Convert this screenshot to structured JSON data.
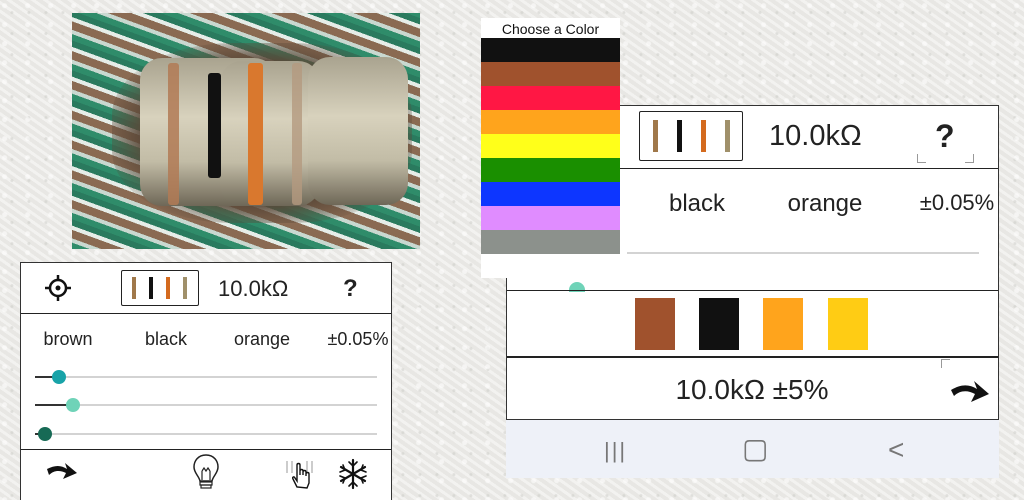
{
  "left_phone": {
    "value": "10.0kΩ",
    "help": "?",
    "band_names": [
      "brown",
      "black",
      "orange",
      "±0.05%"
    ],
    "band_colors": [
      "#a0784a",
      "#111111",
      "#d46a1e",
      "#a0906a"
    ],
    "sliders": [
      {
        "level": 0.07,
        "color": "#18a3a8"
      },
      {
        "level": 0.11,
        "color": "#6fd3b8"
      },
      {
        "level": 0.03,
        "color": "#176a55"
      }
    ],
    "toolbar_icons": [
      "target-icon",
      "arrow-icon",
      "lightbulb-icon",
      "hand-pointer-icon",
      "snowflake-icon"
    ]
  },
  "right_phone": {
    "value": "10.0kΩ",
    "help": "?",
    "band_names": [
      "black",
      "orange",
      "±0.05%"
    ],
    "band_colors": [
      "#a0784a",
      "#111111",
      "#d46a1e",
      "#a0906a"
    ],
    "code_swatches": [
      "#a0522d",
      "#111111",
      "#ffa41c",
      "#ffcc14"
    ],
    "result": "10.0kΩ ±5%"
  },
  "palette": {
    "title": "Choose a Color",
    "colors": [
      "#111111",
      "#a0522d",
      "#ff1744",
      "#ffa41c",
      "#ffff1a",
      "#1a8f00",
      "#0d36ff",
      "#e08cff",
      "#8c918c"
    ]
  },
  "navbar": {
    "recent": "|||",
    "home": "▢",
    "back": "<"
  }
}
